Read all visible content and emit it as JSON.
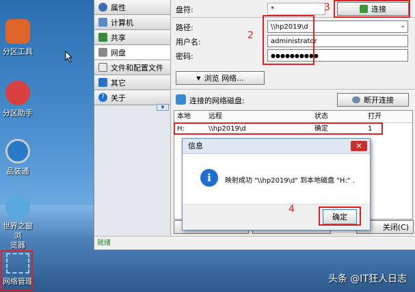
{
  "desktop": {
    "icons": [
      {
        "label": "分区工具",
        "color": "#e0652a"
      },
      {
        "label": "分区助手",
        "color": "#d84040"
      },
      {
        "label": "品装通",
        "color": "#2a78c8"
      },
      {
        "label": "世界之窗浏览器",
        "label_line1": "世界之窗浏",
        "label_line2": "览器",
        "color": "#5aa8e0"
      },
      {
        "label": "网络管理",
        "color": "#3c8ee0"
      }
    ]
  },
  "sidebar": {
    "items": [
      {
        "label": "属性",
        "icon": "properties-icon"
      },
      {
        "label": "计算机",
        "icon": "computer-icon"
      },
      {
        "label": "共享",
        "icon": "share-icon"
      },
      {
        "label": "网盘",
        "icon": "network-drive-icon"
      },
      {
        "label": "文件和配置文件",
        "icon": "files-icon"
      },
      {
        "label": "其它",
        "icon": "other-icon"
      },
      {
        "label": "关于",
        "icon": "about-icon"
      }
    ],
    "active_index": 3
  },
  "form": {
    "drive_label": "盘符:",
    "drive_value": "*",
    "connect_button": "连接",
    "path_label": "路径:",
    "path_value": "\\\\hp2019\\d",
    "username_label": "用户名:",
    "username_value": "administrator",
    "password_label": "密码:",
    "password_value": "●●●●●●●●●●",
    "browse_button": "浏览 网络...",
    "connected_label": "连接的网络磁盘:",
    "disconnect_button": "断开连接"
  },
  "table": {
    "headers": [
      "本地",
      "远程",
      "状态",
      "打开"
    ],
    "rows": [
      [
        "H:",
        "\\\\hp2019\\d",
        "确定",
        "1"
      ]
    ]
  },
  "bottom": {
    "close_button": "关闭(C)",
    "status_text": "就绪"
  },
  "dialog": {
    "title": "信息",
    "message": "映射成功 \"\\\\hp2019\\d\" 到本地磁盘 \"H:\" .",
    "ok_button": "确定",
    "close_symbol": "✕"
  },
  "annotations": [
    "2",
    "3",
    "4"
  ],
  "watermark": "头条 @IT狂人日志",
  "colors": {
    "annotation": "#e02020",
    "status_ready": "#1a8a1a",
    "info_icon": "#1f6fd0"
  }
}
